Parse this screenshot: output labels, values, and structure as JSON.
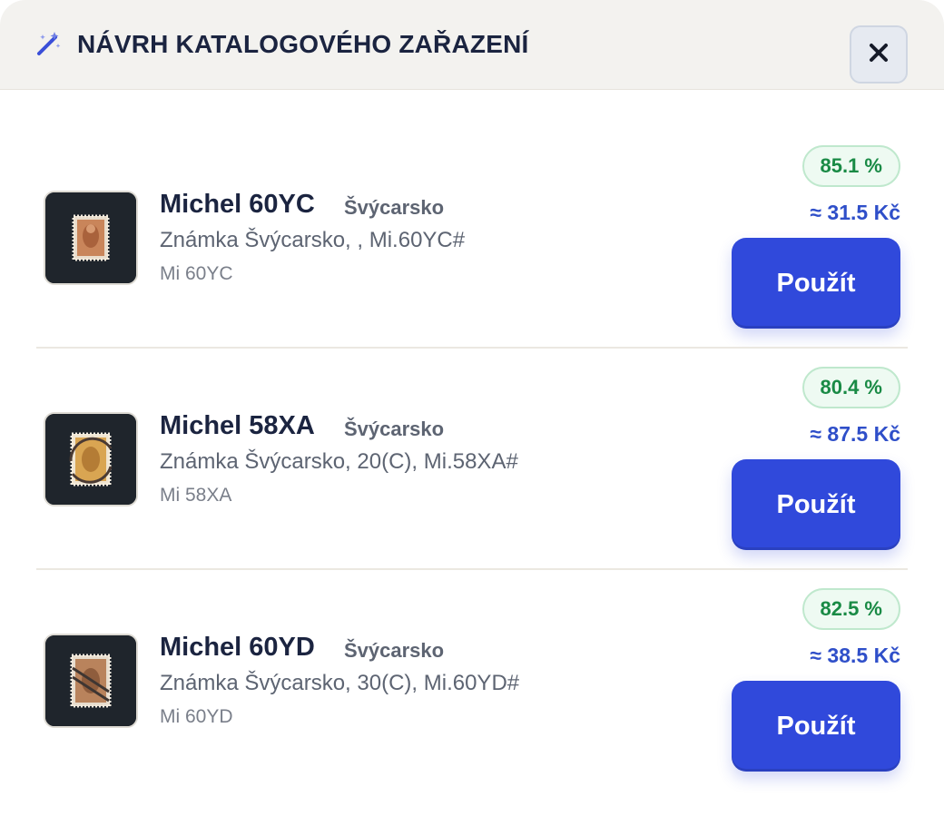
{
  "header": {
    "icon": "magic-wand-icon",
    "title": "NÁVRH KATALOGOVÉHO ZAŘAZENÍ",
    "close_icon": "close-icon"
  },
  "items": [
    {
      "name": "Michel 60YC",
      "country": "Švýcarsko",
      "description": "Známka Švýcarsko, , Mi.60YC#",
      "code": "Mi 60YC",
      "match": "85.1 %",
      "price": "≈ 31.5 Kč",
      "button": "Použít",
      "stamp_color": "#c9855a"
    },
    {
      "name": "Michel 58XA",
      "country": "Švýcarsko",
      "description": "Známka Švýcarsko, 20(C), Mi.58XA#",
      "code": "Mi 58XA",
      "match": "80.4 %",
      "price": "≈ 87.5 Kč",
      "button": "Použít",
      "stamp_color": "#d9a552"
    },
    {
      "name": "Michel 60YD",
      "country": "Švýcarsko",
      "description": "Známka Švýcarsko, 30(C), Mi.60YD#",
      "code": "Mi 60YD",
      "match": "82.5 %",
      "price": "≈ 38.5 Kč",
      "button": "Použít",
      "stamp_color": "#b9835c"
    }
  ],
  "colors": {
    "accent": "#3049db",
    "price": "#2f4fc9",
    "match_text": "#198a45",
    "match_bg": "#eefaf2"
  }
}
